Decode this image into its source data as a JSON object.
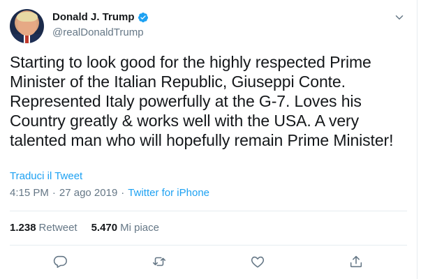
{
  "author": {
    "name": "Donald J. Trump",
    "handle": "@realDonaldTrump",
    "verified": true
  },
  "tweet": {
    "text": "Starting to look good for the highly respected Prime Minister of the Italian Republic, Giuseppi Conte. Represented Italy powerfully at the G-7. Loves his Country greatly & works well with the USA. A very talented man who will hopefully remain Prime Minister!",
    "translate_label": "Traduci il Tweet",
    "time": "4:15 PM",
    "date": "27 ago 2019",
    "separator": "·",
    "source": "Twitter for iPhone"
  },
  "stats": {
    "retweets_count": "1.238",
    "retweets_label": "Retweet",
    "likes_count": "5.470",
    "likes_label": "Mi piace"
  },
  "icons": {
    "verified": "verified-badge-icon",
    "menu": "chevron-down-icon",
    "reply": "reply-icon",
    "retweet": "retweet-icon",
    "like": "heart-icon",
    "share": "share-icon"
  },
  "colors": {
    "accent": "#1da1f2",
    "muted": "#657786",
    "text": "#14171a",
    "border": "#e6ecf0"
  }
}
